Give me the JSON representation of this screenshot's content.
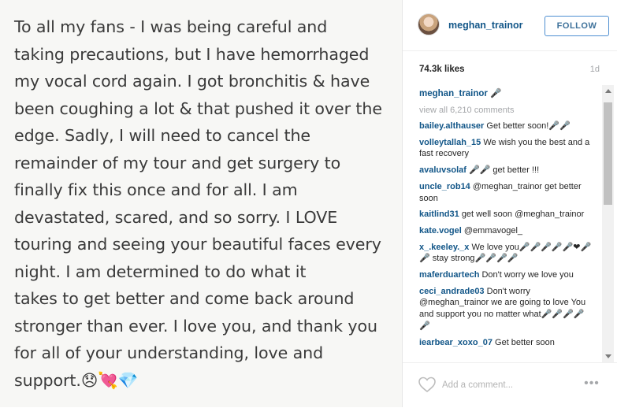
{
  "post": {
    "text": "To all my fans - I was being careful and\ntaking precautions, but I have hemorrhaged\nmy vocal cord again. I got bronchitis & have\nbeen coughing a lot & that pushed it over the\nedge. Sadly, I will need to cancel the\nremainder of my tour and get surgery to\nfinally fix this once and for all. I am\ndevastated, scared, and so sorry. I LOVE\ntouring and seeing your beautiful faces every\nnight. I am determined to do what it\ntakes to get better and come back around\nstronger than ever. I love you, and thank you\nfor all of your understanding, love and\nsupport.😞💘💎"
  },
  "header": {
    "username": "meghan_trainor",
    "follow_label": "FOLLOW"
  },
  "stats": {
    "likes": "74.3k likes",
    "age": "1d"
  },
  "caption": {
    "user": "meghan_trainor",
    "text": "🎤"
  },
  "view_all": "view all 6,210 comments",
  "comments": [
    {
      "user": "bailey.althauser",
      "text": "Get better soon!🎤🎤"
    },
    {
      "user": "volleytallah_15",
      "text": "We wish you the best and a fast recovery"
    },
    {
      "user": "avaluvsolaf",
      "text": "🎤🎤 get better !!!"
    },
    {
      "user": "uncle_rob14",
      "text": "@meghan_trainor get better soon"
    },
    {
      "user": "kaitlind31",
      "text": "get well soon @meghan_trainor"
    },
    {
      "user": "kate.vogel",
      "text": "@emmavogel_"
    },
    {
      "user": "x_.keeley._x",
      "text": "We love you🎤🎤🎤🎤🎤❤🎤🎤 stay strong🎤🎤🎤🎤"
    },
    {
      "user": "maferduartech",
      "text": "Don't worry we love you"
    },
    {
      "user": "ceci_andrade03",
      "text": "Don't worry @meghan_trainor we are going to love You and support you no matter what🎤🎤🎤🎤🎤"
    },
    {
      "user": "iearbear_xoxo_07",
      "text": "Get better soon"
    }
  ],
  "footer": {
    "comment_placeholder": "Add a comment...",
    "more_label": "•••"
  },
  "colors": {
    "link": "#125688",
    "follow_border": "#4e8fd1",
    "muted": "#a5a7aa"
  },
  "icons": [
    "heart-icon",
    "more-options-icon",
    "scroll-up-arrow-icon",
    "scroll-down-arrow-icon"
  ]
}
